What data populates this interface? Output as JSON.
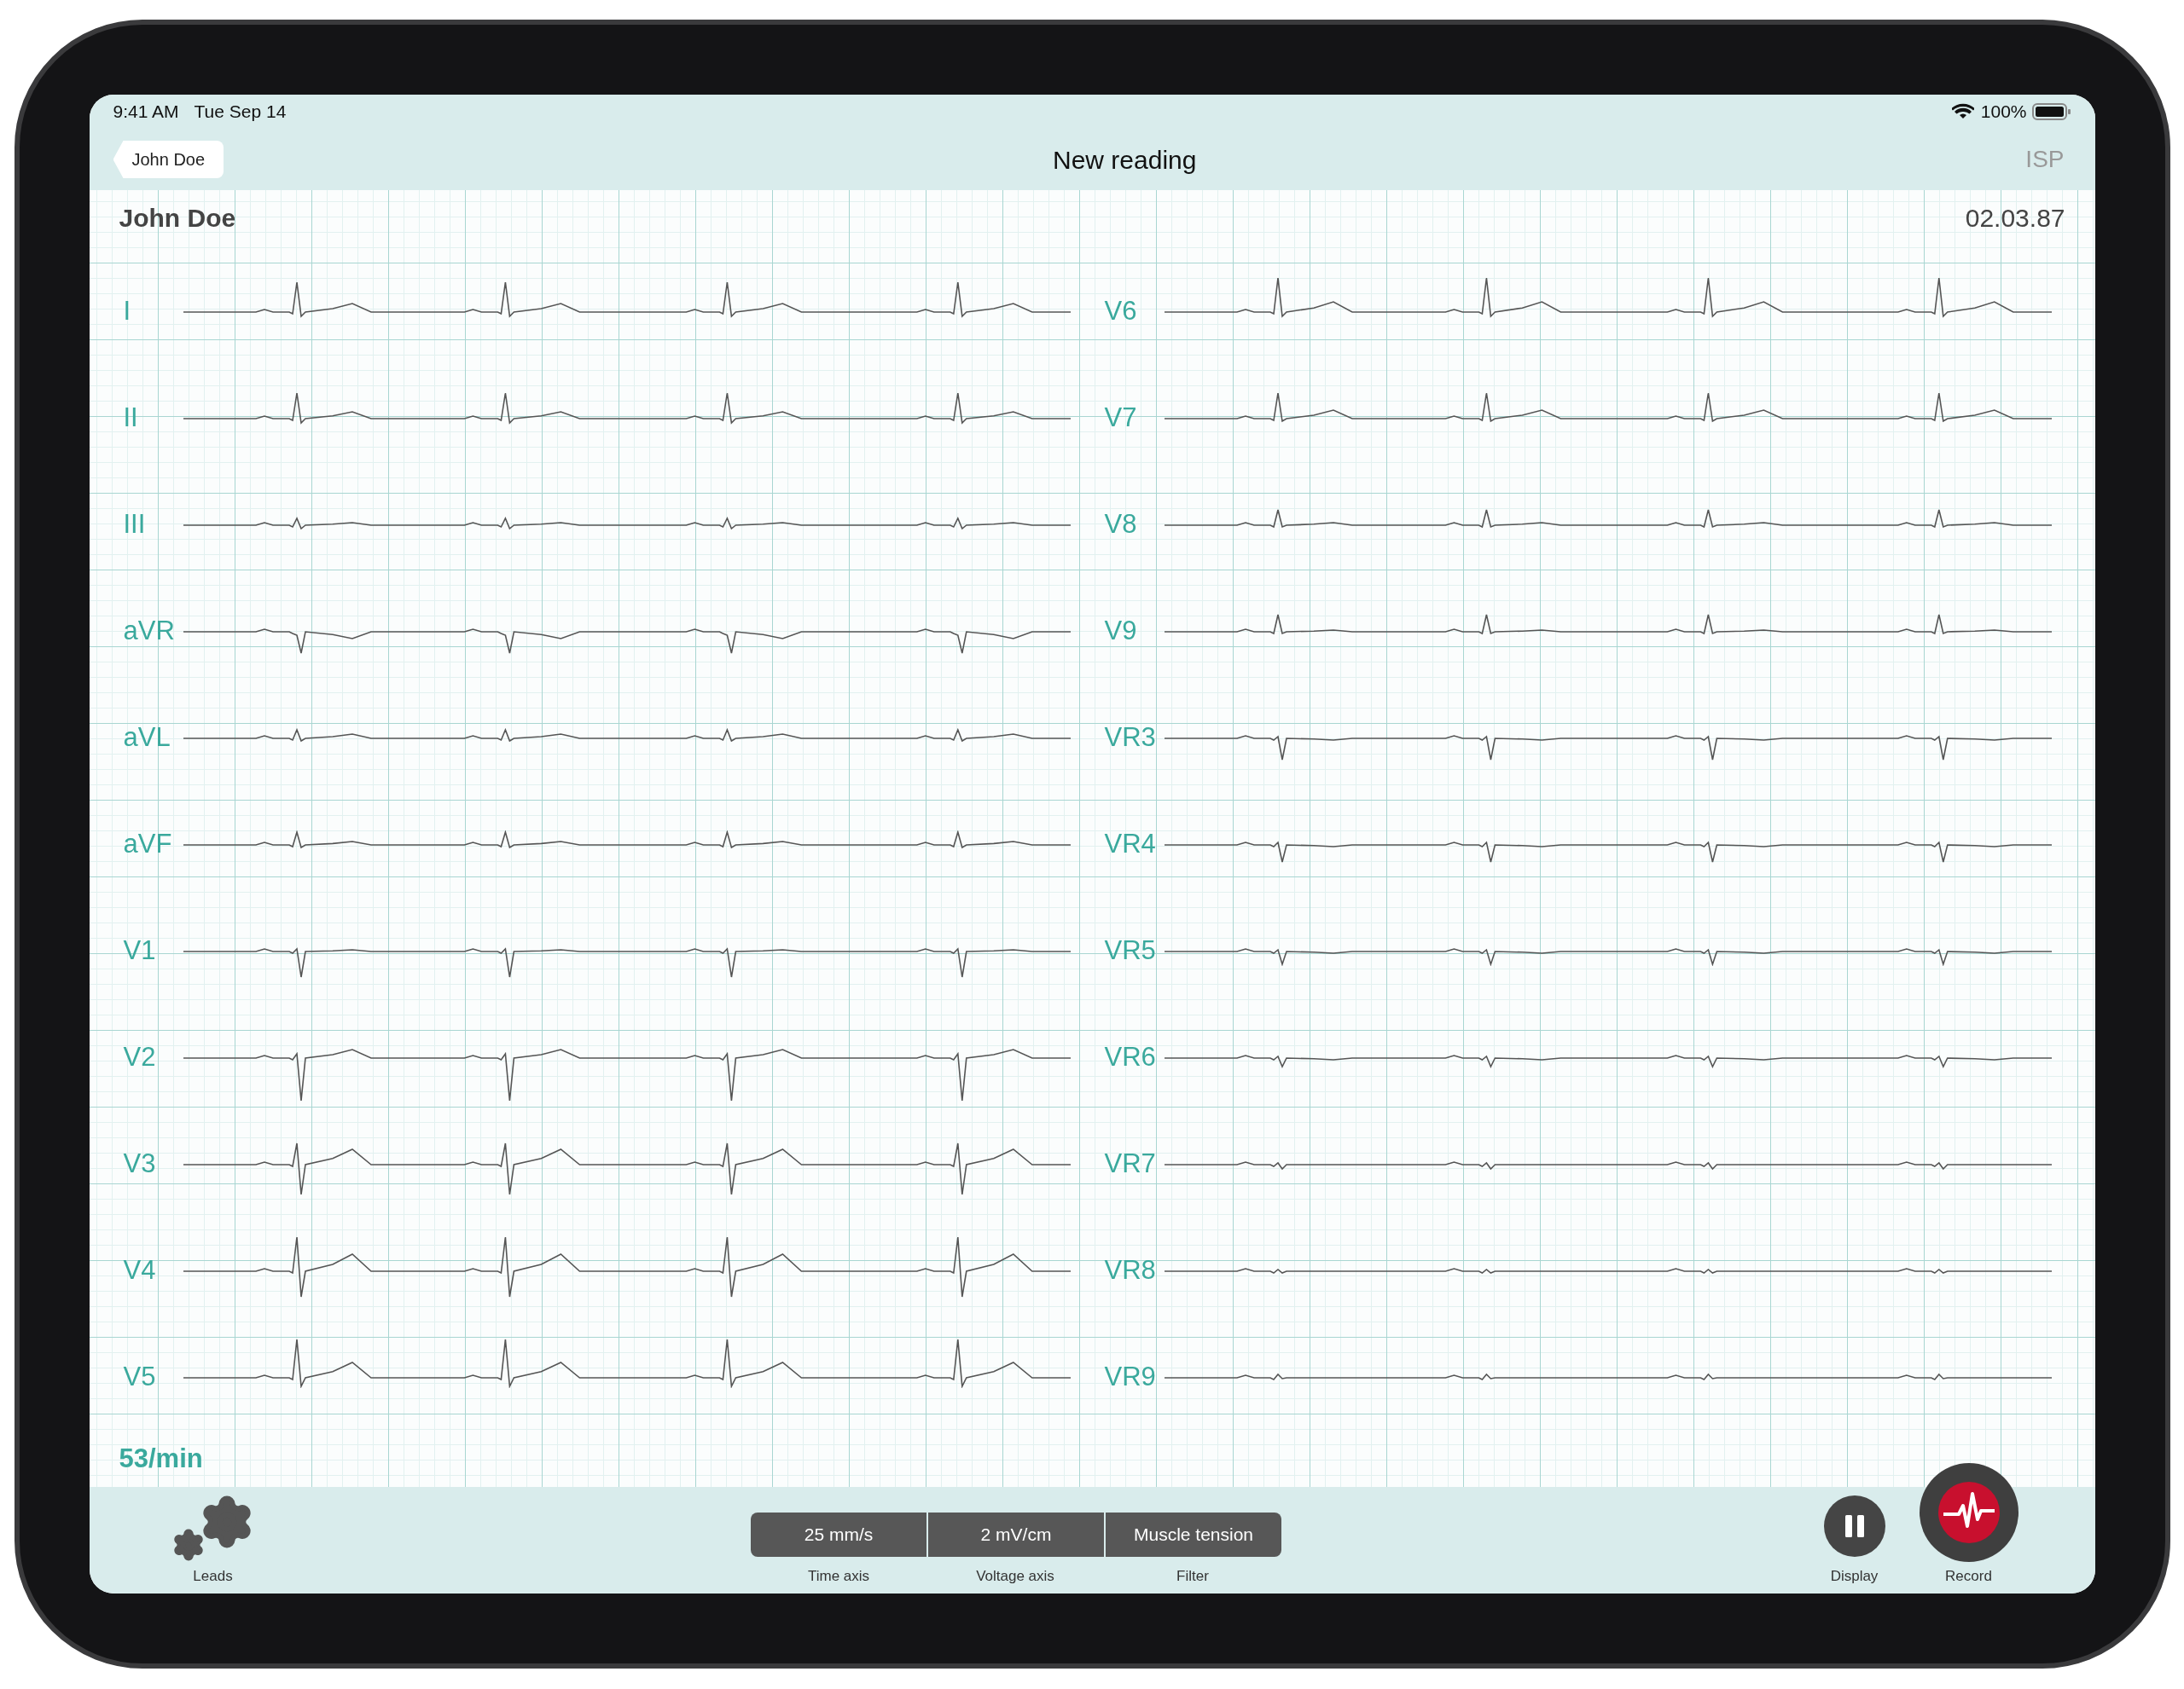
{
  "status_bar": {
    "time": "9:41 AM",
    "date": "Tue Sep 14",
    "battery": "100%"
  },
  "nav": {
    "back": "John Doe",
    "title": "New reading",
    "action": "ISP"
  },
  "patient": {
    "name": "John Doe",
    "date": "02.03.87"
  },
  "leads_left": [
    {
      "name": "I"
    },
    {
      "name": "II"
    },
    {
      "name": "III"
    },
    {
      "name": "aVR"
    },
    {
      "name": "aVL"
    },
    {
      "name": "aVF"
    },
    {
      "name": "V1"
    },
    {
      "name": "V2"
    },
    {
      "name": "V3"
    },
    {
      "name": "V4"
    },
    {
      "name": "V5"
    }
  ],
  "leads_right": [
    {
      "name": "V6"
    },
    {
      "name": "V7"
    },
    {
      "name": "V8"
    },
    {
      "name": "V9"
    },
    {
      "name": "VR3"
    },
    {
      "name": "VR4"
    },
    {
      "name": "VR5"
    },
    {
      "name": "VR6"
    },
    {
      "name": "VR7"
    },
    {
      "name": "VR8"
    },
    {
      "name": "VR9"
    }
  ],
  "heart_rate": "53/min",
  "toolbar": {
    "leads": "Leads",
    "settings": [
      {
        "value": "25 mm/s",
        "label": "Time axis"
      },
      {
        "value": "2 mV/cm",
        "label": "Voltage axis"
      },
      {
        "value": "Muscle tension",
        "label": "Filter"
      }
    ],
    "display": "Display",
    "record": "Record"
  }
}
